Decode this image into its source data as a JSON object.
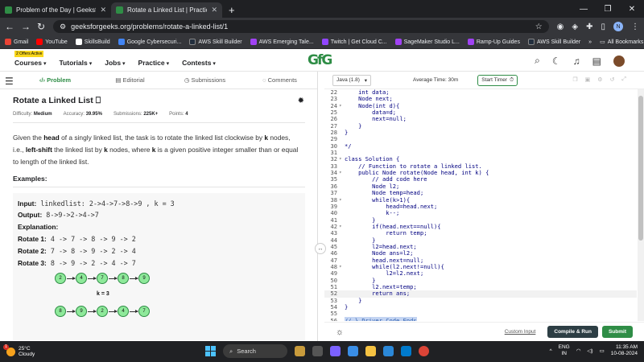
{
  "browser": {
    "tabs": [
      {
        "title": "Problem of the Day | GeeksforG",
        "active": false
      },
      {
        "title": "Rotate a Linked List | Practice |",
        "active": true
      }
    ],
    "new_tab": "+",
    "url": "geeksforgeeks.org/problems/rotate-a-linked-list/1",
    "bookmarks": [
      {
        "label": "Gmail",
        "color": "#ea4335"
      },
      {
        "label": "YouTube",
        "color": "#ff0000"
      },
      {
        "label": "SkillsBuild",
        "color": "#ffffff"
      },
      {
        "label": "Google Cybersecuri...",
        "color": "#4285f4"
      },
      {
        "label": "AWS Skill Builder",
        "color": "#232f3e"
      },
      {
        "label": "AWS Emerging Tale...",
        "color": "#a142f4"
      },
      {
        "label": "Twitch | Get Cloud C...",
        "color": "#9146ff"
      },
      {
        "label": "SageMaker Studio L...",
        "color": "#a142f4"
      },
      {
        "label": "Ramp-Up Guides",
        "color": "#a142f4"
      },
      {
        "label": "AWS Skill Builder",
        "color": "#232f3e"
      }
    ],
    "all_bookmarks": "All Bookmarks",
    "profile_initial": "N"
  },
  "site": {
    "offer_badge": "2 Offers Active",
    "nav": [
      "Courses",
      "Tutorials",
      "Jobs",
      "Practice",
      "Contests"
    ],
    "logo": "GfG"
  },
  "problem": {
    "tabs": [
      "Problem",
      "Editorial",
      "Submissions",
      "Comments"
    ],
    "title": "Rotate a Linked List",
    "difficulty_label": "Difficulty:",
    "difficulty": "Medium",
    "accuracy_label": "Accuracy:",
    "accuracy": "39.95%",
    "submissions_label": "Submissions:",
    "submissions": "225K+",
    "points_label": "Points:",
    "points": "4",
    "examples_heading": "Examples:",
    "example": {
      "input_label": "Input:",
      "input": "linkedlist: 2->4->7->8->9 , k = 3",
      "output_label": "Output:",
      "output": "8->9->2->4->7",
      "explanation_label": "Explanation:",
      "rotations": [
        {
          "label": "Rotate 1:",
          "value": "4 -> 7 -> 8 -> 9 -> 2"
        },
        {
          "label": "Rotate 2:",
          "value": "7 -> 8 -> 9 -> 2 -> 4"
        },
        {
          "label": "Rotate 3:",
          "value": "8 -> 9 -> 2 -> 4 -> 7"
        }
      ],
      "diagram_top": [
        "2",
        "4",
        "7",
        "8",
        "9"
      ],
      "diagram_label": "k = 3",
      "diagram_bottom": [
        "8",
        "9",
        "2",
        "4",
        "7"
      ]
    }
  },
  "editor": {
    "language": "Java (1.8)",
    "avg_time": "Average Time: 30m",
    "timer": "Start Timer",
    "lines": [
      {
        "n": "22",
        "t": "    int data;"
      },
      {
        "n": "23",
        "t": "    Node next;"
      },
      {
        "n": "24",
        "t": "    Node(int d){",
        "fold": true
      },
      {
        "n": "25",
        "t": "        data=d;"
      },
      {
        "n": "26",
        "t": "        next=null;"
      },
      {
        "n": "27",
        "t": "    }"
      },
      {
        "n": "28",
        "t": "}"
      },
      {
        "n": "29",
        "t": ""
      },
      {
        "n": "30",
        "t": "*/"
      },
      {
        "n": "31",
        "t": ""
      },
      {
        "n": "32",
        "t": "class Solution {",
        "fold": true
      },
      {
        "n": "33",
        "t": "    // Function to rotate a linked list."
      },
      {
        "n": "34",
        "t": "    public Node rotate(Node head, int k) {",
        "fold": true
      },
      {
        "n": "35",
        "t": "        // add code here"
      },
      {
        "n": "36",
        "t": "        Node l2;"
      },
      {
        "n": "37",
        "t": "        Node temp=head;"
      },
      {
        "n": "38",
        "t": "        while(k>1){",
        "fold": true
      },
      {
        "n": "39",
        "t": "            head=head.next;"
      },
      {
        "n": "40",
        "t": "            k--;"
      },
      {
        "n": "41",
        "t": "        }"
      },
      {
        "n": "42",
        "t": "        if(head.next==null){",
        "fold": true
      },
      {
        "n": "43",
        "t": "            return temp;"
      },
      {
        "n": "44",
        "t": "        }"
      },
      {
        "n": "45",
        "t": "        l2=head.next;"
      },
      {
        "n": "46",
        "t": "        Node ans=l2;"
      },
      {
        "n": "47",
        "t": "        head.next=null;"
      },
      {
        "n": "48",
        "t": "        while(l2.next!=null){",
        "fold": true
      },
      {
        "n": "49",
        "t": "            l2=l2.next;"
      },
      {
        "n": "50",
        "t": "        }"
      },
      {
        "n": "51",
        "t": "        l2.next=temp;"
      },
      {
        "n": "52",
        "t": "        return ans;",
        "highlight": true
      },
      {
        "n": "53",
        "t": "    }"
      },
      {
        "n": "54",
        "t": "}"
      },
      {
        "n": "55",
        "t": ""
      },
      {
        "n": "56",
        "t": "// } Driver Code Ends",
        "selected": true
      }
    ],
    "custom_input": "Custom Input",
    "compile_run": "Compile & Run",
    "submit": "Submit"
  },
  "taskbar": {
    "temp": "25°C",
    "condition": "Cloudy",
    "search": "Search",
    "lang_top": "ENG",
    "lang_bottom": "IN",
    "time": "11:35 AM",
    "date": "10-08-2024"
  }
}
